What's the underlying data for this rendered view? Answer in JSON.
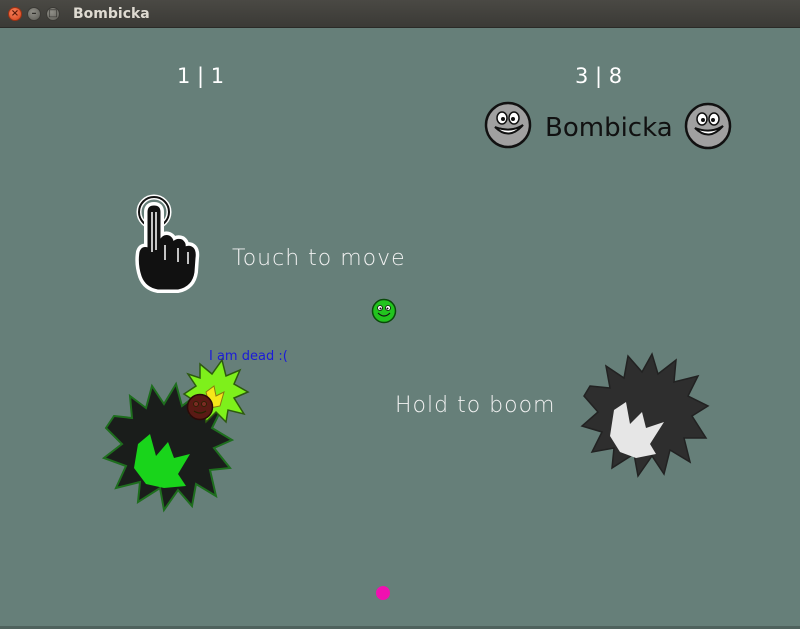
{
  "window": {
    "title": "Bombicka",
    "close_glyph": "×",
    "min_glyph": "–",
    "max_glyph": "□"
  },
  "hud": {
    "left_score": "1 | 1",
    "right_score": "3 | 8",
    "game_title": "Bombicka"
  },
  "tutorial": {
    "touch_text": "Touch to move",
    "hold_text": "Hold to boom"
  },
  "player": {
    "dead_message": "I am dead :("
  },
  "colors": {
    "background": "#667f79",
    "player_green": "#22c41e",
    "explosion_dark": "#1a1d1b",
    "explosion_green": "#19d41b",
    "explosion_grey": "#2e2e2e",
    "fire_lime": "#7ef01b",
    "dead_text": "#1b1bd8",
    "pink_dot": "#f010b0"
  },
  "icons": {
    "hand": "pointer-hand-icon",
    "smiley": "smiley-face-icon"
  }
}
